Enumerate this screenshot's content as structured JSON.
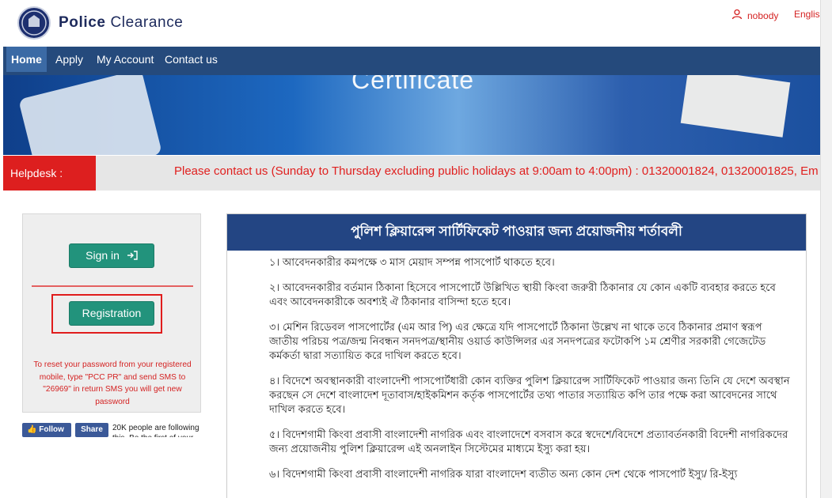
{
  "header": {
    "brand_bold": "Police",
    "brand_rest": " Clearance",
    "user_label": "nobody",
    "language_label": "English"
  },
  "nav": {
    "items": [
      "Home",
      "Apply",
      "My Account",
      "Contact us"
    ],
    "active": "Home"
  },
  "banner": {
    "title_text": "Certificate"
  },
  "helpdesk": {
    "label": "Helpdesk :",
    "message": "Please contact us (Sunday to Thursday excluding public holidays at 9:00am to 4:00pm) : 01320001824, 01320001825, Em"
  },
  "sidebar": {
    "signin_label": "Sign in",
    "registration_label": "Registration",
    "reset_note": "To reset your password from your registered mobile, type \"PCC PR\" and send SMS to \"26969\" in return SMS you will get new password"
  },
  "social": {
    "follow_label": "Follow",
    "share_label": "Share",
    "count_text": "20K people are following this. Be the first of your"
  },
  "content": {
    "heading": "পুলিশ ক্লিয়ারেন্স সার্টিফিকেট পাওয়ার জন্য প্রয়োজনীয় শর্তাবলী",
    "clauses": [
      "১। আবেদনকারীর কমপক্ষে ৩ মাস মেয়াদ সম্পন্ন পাসপোর্ট থাকতে হবে।",
      "২। আবেদনকারীর বর্তমান ঠিকানা হিসেবে পাসপোর্টে উল্লিখিত স্থায়ী কিংবা জরুরী ঠিকানার যে কোন একটি ব্যবহার করতে হবে এবং আবেদনকারীকে অবশ্যই ঐ ঠিকানার বাসিন্দা হতে হবে।",
      "৩। মেশিন রিডেবল পাসপোর্টের (এম আর পি) এর ক্ষেত্রে যদি পাসপোর্টে ঠিকানা উল্লেখ না থাকে তবে ঠিকানার প্রমাণ স্বরূপ জাতীয় পরিচয় পত্র/জন্ম নিবন্ধন সনদপত্র/স্থানীয় ওয়ার্ড কাউন্সিলর এর সনদপত্রের ফটোকপি ১ম শ্রেণীর সরকারী গেজেটেড কর্মকর্তা দ্বারা সত্যায়িত করে দাখিল করতে হবে।",
      "৪। বিদেশে অবস্থানকারী বাংলাদেশী পাসপোর্টধারী কোন ব্যক্তির পুলিশ ক্লিয়ারেন্স সার্টিফিকেট পাওয়ার জন্য তিনি যে দেশে অবস্থান করছেন সে দেশে বাংলাদেশ দূতাবাস/হাইকমিশন কর্তৃক পাসপোর্টের তথ্য পাতার সত্যায়িত কপি তার পক্ষে করা আবেদনের সাথে দাখিল করতে হবে।",
      "৫। বিদেশগামী কিংবা প্রবাসী বাংলাদেশী নাগরিক এবং বাংলাদেশে বসবাস করে স্বদেশে/বিদেশে প্রত্যাবর্তনকারী বিদেশী নাগরিকদের জন্য প্রয়োজনীয় পুলিশ ক্লিয়ারেন্স এই অনলাইন সিস্টেমের মাধ্যমে ইস্যু করা হয়।",
      "৬। বিদেশগামী কিংবা প্রবাসী বাংলাদেশী নাগরিক যারা বাংলাদেশ ব্যতীত অন্য কোন দেশ থেকে পাসপোর্ট ইস্যু/ রি-ইস্যু"
    ]
  }
}
